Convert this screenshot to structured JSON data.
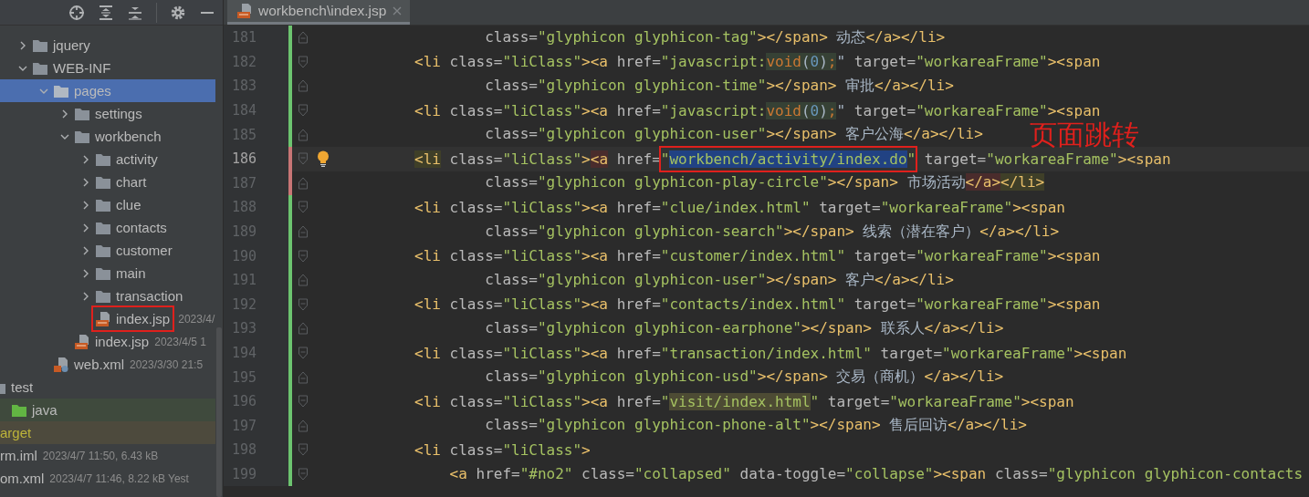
{
  "project_tree": {
    "groups": [
      {
        "kind": "webapp",
        "items": [
          {
            "name": "jquery",
            "kind": "folder",
            "expanded": false,
            "selected": false
          },
          {
            "name": "WEB-INF",
            "kind": "folder",
            "expanded": true,
            "selected": false,
            "children": [
              {
                "name": "pages",
                "kind": "folder",
                "expanded": true,
                "selected": true,
                "children": [
                  {
                    "name": "settings",
                    "kind": "folder",
                    "expanded": false,
                    "selected": false
                  },
                  {
                    "name": "workbench",
                    "kind": "folder",
                    "expanded": true,
                    "selected": false,
                    "children": [
                      {
                        "name": "activity",
                        "kind": "folder",
                        "expanded": false,
                        "selected": false
                      },
                      {
                        "name": "chart",
                        "kind": "folder",
                        "expanded": false,
                        "selected": false
                      },
                      {
                        "name": "clue",
                        "kind": "folder",
                        "expanded": false,
                        "selected": false
                      },
                      {
                        "name": "contacts",
                        "kind": "folder",
                        "expanded": false,
                        "selected": false
                      },
                      {
                        "name": "customer",
                        "kind": "folder",
                        "expanded": false,
                        "selected": false
                      },
                      {
                        "name": "main",
                        "kind": "folder",
                        "expanded": false,
                        "selected": false
                      },
                      {
                        "name": "transaction",
                        "kind": "folder",
                        "expanded": false,
                        "selected": false
                      },
                      {
                        "name": "index.jsp",
                        "kind": "jsp",
                        "info": "2023/4/",
                        "selected": false,
                        "annotated": true
                      }
                    ]
                  },
                  {
                    "name": "index.jsp",
                    "kind": "jsp",
                    "info": "2023/4/5 1",
                    "selected": false
                  }
                ]
              },
              {
                "name": "web.xml",
                "kind": "web_xml",
                "info": "2023/3/30 21:5",
                "selected": false
              }
            ]
          }
        ]
      },
      {
        "kind": "source",
        "items": [
          {
            "name": "test",
            "kind": "folder",
            "selected": false,
            "children": [
              {
                "name": "java",
                "kind": "source_folder",
                "selected": false
              }
            ]
          }
        ]
      },
      {
        "kind": "project",
        "items": [
          {
            "name": "arget",
            "kind": "excluded",
            "selected": false
          },
          {
            "name": "rm.iml",
            "kind": "file",
            "info": "2023/4/7 11:50, 6.43 kB",
            "selected": false
          },
          {
            "name": "om.xml",
            "kind": "file",
            "info": "2023/4/7 11:46, 8.22 kB Yest",
            "selected": false
          }
        ]
      }
    ]
  },
  "editor": {
    "tabs": [
      {
        "title": "workbench\\index.jsp",
        "selected": true
      }
    ],
    "annotation": {
      "text": "页面跳转"
    },
    "lines": [
      {
        "number": "181",
        "kind": "continuation",
        "changed": false,
        "segments": [
          {
            "kind": "attr",
            "text": "class="
          },
          {
            "kind": "str",
            "text": "\"glyphicon glyphicon-tag\""
          },
          {
            "kind": "tag",
            "text": "></span>"
          },
          {
            "kind": "plain",
            "text": " 动态"
          },
          {
            "kind": "tag",
            "text": "</a></li>"
          }
        ]
      },
      {
        "number": "182",
        "kind": "tag",
        "changed": false,
        "segments": [
          {
            "kind": "tag",
            "text": "<li "
          },
          {
            "kind": "attr",
            "text": "class="
          },
          {
            "kind": "str",
            "text": "\"liClass\""
          },
          {
            "kind": "tag",
            "text": "><a "
          },
          {
            "kind": "attr",
            "text": "href="
          },
          {
            "kind": "str",
            "text": "\"javascript:"
          },
          {
            "kind": "kw",
            "text": "void",
            "injected": true
          },
          {
            "kind": "plain",
            "text": "(",
            "injected": true
          },
          {
            "kind": "num",
            "text": "0",
            "injected": true
          },
          {
            "kind": "plain",
            "text": ")",
            "injected": true
          },
          {
            "kind": "kw",
            "text": ";",
            "injected": true
          },
          {
            "kind": "plain",
            "text": "\""
          },
          {
            "kind": "attr",
            "text": " target="
          },
          {
            "kind": "str",
            "text": "\"workareaFrame\""
          },
          {
            "kind": "tag",
            "text": "><span"
          }
        ]
      },
      {
        "number": "183",
        "kind": "continuation",
        "changed": false,
        "segments": [
          {
            "kind": "attr",
            "text": "class="
          },
          {
            "kind": "str",
            "text": "\"glyphicon glyphicon-time\""
          },
          {
            "kind": "tag",
            "text": "></span>"
          },
          {
            "kind": "plain",
            "text": " 审批"
          },
          {
            "kind": "tag",
            "text": "</a></li>"
          }
        ]
      },
      {
        "number": "184",
        "kind": "tag",
        "changed": false,
        "segments": [
          {
            "kind": "tag",
            "text": "<li "
          },
          {
            "kind": "attr",
            "text": "class="
          },
          {
            "kind": "str",
            "text": "\"liClass\""
          },
          {
            "kind": "tag",
            "text": "><a "
          },
          {
            "kind": "attr",
            "text": "href="
          },
          {
            "kind": "str",
            "text": "\"javascript:"
          },
          {
            "kind": "kw",
            "text": "void",
            "injected": true
          },
          {
            "kind": "plain",
            "text": "(",
            "injected": true
          },
          {
            "kind": "num",
            "text": "0",
            "injected": true
          },
          {
            "kind": "plain",
            "text": ")",
            "injected": true
          },
          {
            "kind": "kw",
            "text": ";",
            "injected": true
          },
          {
            "kind": "plain",
            "text": "\""
          },
          {
            "kind": "attr",
            "text": " target="
          },
          {
            "kind": "str",
            "text": "\"workareaFrame\""
          },
          {
            "kind": "tag",
            "text": "><span"
          }
        ]
      },
      {
        "number": "185",
        "kind": "continuation",
        "changed": false,
        "segments": [
          {
            "kind": "attr",
            "text": "class="
          },
          {
            "kind": "str",
            "text": "\"glyphicon glyphicon-user\""
          },
          {
            "kind": "tag",
            "text": "></span>"
          },
          {
            "kind": "plain",
            "text": " 客户公海"
          },
          {
            "kind": "tag",
            "text": "</a></li>"
          }
        ]
      },
      {
        "number": "186",
        "kind": "tag",
        "changed": true,
        "current": true,
        "intention": true,
        "segments": [
          {
            "kind": "tag",
            "text": "<li",
            "matched": true
          },
          {
            "kind": "attr",
            "text": " class="
          },
          {
            "kind": "str",
            "text": "\"liClass\""
          },
          {
            "kind": "tag",
            "text": ">"
          },
          {
            "kind": "tag",
            "text": "<a",
            "unmatched": true
          },
          {
            "kind": "attr",
            "text": " href="
          },
          {
            "kind": "str",
            "text": "\"",
            "annotated": true
          },
          {
            "kind": "str",
            "text": "workbench/activity/index.do",
            "selected": true,
            "annotated": true
          },
          {
            "kind": "str",
            "text": "\"",
            "annotated": true
          },
          {
            "kind": "attr",
            "text": " target="
          },
          {
            "kind": "str",
            "text": "\"workareaFrame\""
          },
          {
            "kind": "tag",
            "text": "><span"
          }
        ]
      },
      {
        "number": "187",
        "kind": "continuation",
        "changed": true,
        "segments": [
          {
            "kind": "attr",
            "text": "class="
          },
          {
            "kind": "str",
            "text": "\"glyphicon glyphicon-play-circle\""
          },
          {
            "kind": "tag",
            "text": "></span>"
          },
          {
            "kind": "plain",
            "text": " 市场活动"
          },
          {
            "kind": "tag",
            "text": "</a>",
            "unmatched": true
          },
          {
            "kind": "tag",
            "text": "</li>",
            "matched": true
          }
        ]
      },
      {
        "number": "188",
        "kind": "tag",
        "changed": false,
        "segments": [
          {
            "kind": "tag",
            "text": "<li "
          },
          {
            "kind": "attr",
            "text": "class="
          },
          {
            "kind": "str",
            "text": "\"liClass\""
          },
          {
            "kind": "tag",
            "text": "><a "
          },
          {
            "kind": "attr",
            "text": "href="
          },
          {
            "kind": "str",
            "text": "\"clue/index.html\""
          },
          {
            "kind": "attr",
            "text": " target="
          },
          {
            "kind": "str",
            "text": "\"workareaFrame\""
          },
          {
            "kind": "tag",
            "text": "><span"
          }
        ]
      },
      {
        "number": "189",
        "kind": "continuation",
        "changed": false,
        "segments": [
          {
            "kind": "attr",
            "text": "class="
          },
          {
            "kind": "str",
            "text": "\"glyphicon glyphicon-search\""
          },
          {
            "kind": "tag",
            "text": "></span>"
          },
          {
            "kind": "plain",
            "text": " 线索（潜在客户）"
          },
          {
            "kind": "tag",
            "text": "</a></li>"
          }
        ]
      },
      {
        "number": "190",
        "kind": "tag",
        "changed": false,
        "segments": [
          {
            "kind": "tag",
            "text": "<li "
          },
          {
            "kind": "attr",
            "text": "class="
          },
          {
            "kind": "str",
            "text": "\"liClass\""
          },
          {
            "kind": "tag",
            "text": "><a "
          },
          {
            "kind": "attr",
            "text": "href="
          },
          {
            "kind": "str",
            "text": "\"customer/index.html\""
          },
          {
            "kind": "attr",
            "text": " target="
          },
          {
            "kind": "str",
            "text": "\"workareaFrame\""
          },
          {
            "kind": "tag",
            "text": "><span"
          }
        ]
      },
      {
        "number": "191",
        "kind": "continuation",
        "changed": false,
        "segments": [
          {
            "kind": "attr",
            "text": "class="
          },
          {
            "kind": "str",
            "text": "\"glyphicon glyphicon-user\""
          },
          {
            "kind": "tag",
            "text": "></span>"
          },
          {
            "kind": "plain",
            "text": " 客户"
          },
          {
            "kind": "tag",
            "text": "</a></li>"
          }
        ]
      },
      {
        "number": "192",
        "kind": "tag",
        "changed": false,
        "segments": [
          {
            "kind": "tag",
            "text": "<li "
          },
          {
            "kind": "attr",
            "text": "class="
          },
          {
            "kind": "str",
            "text": "\"liClass\""
          },
          {
            "kind": "tag",
            "text": "><a "
          },
          {
            "kind": "attr",
            "text": "href="
          },
          {
            "kind": "str",
            "text": "\"contacts/index.html\""
          },
          {
            "kind": "attr",
            "text": " target="
          },
          {
            "kind": "str",
            "text": "\"workareaFrame\""
          },
          {
            "kind": "tag",
            "text": "><span"
          }
        ]
      },
      {
        "number": "193",
        "kind": "continuation",
        "changed": false,
        "segments": [
          {
            "kind": "attr",
            "text": "class="
          },
          {
            "kind": "str",
            "text": "\"glyphicon glyphicon-earphone\""
          },
          {
            "kind": "tag",
            "text": "></span>"
          },
          {
            "kind": "plain",
            "text": " 联系人"
          },
          {
            "kind": "tag",
            "text": "</a></li>"
          }
        ]
      },
      {
        "number": "194",
        "kind": "tag",
        "changed": false,
        "segments": [
          {
            "kind": "tag",
            "text": "<li "
          },
          {
            "kind": "attr",
            "text": "class="
          },
          {
            "kind": "str",
            "text": "\"liClass\""
          },
          {
            "kind": "tag",
            "text": "><a "
          },
          {
            "kind": "attr",
            "text": "href="
          },
          {
            "kind": "str",
            "text": "\"transaction/index.html\""
          },
          {
            "kind": "attr",
            "text": " target="
          },
          {
            "kind": "str",
            "text": "\"workareaFrame\""
          },
          {
            "kind": "tag",
            "text": "><span"
          }
        ]
      },
      {
        "number": "195",
        "kind": "continuation",
        "changed": false,
        "segments": [
          {
            "kind": "attr",
            "text": "class="
          },
          {
            "kind": "str",
            "text": "\"glyphicon glyphicon-usd\""
          },
          {
            "kind": "tag",
            "text": "></span>"
          },
          {
            "kind": "plain",
            "text": " 交易（商机）"
          },
          {
            "kind": "tag",
            "text": "</a></li>"
          }
        ]
      },
      {
        "number": "196",
        "kind": "tag",
        "changed": false,
        "segments": [
          {
            "kind": "tag",
            "text": "<li "
          },
          {
            "kind": "attr",
            "text": "class="
          },
          {
            "kind": "str",
            "text": "\"liClass\""
          },
          {
            "kind": "tag",
            "text": "><a "
          },
          {
            "kind": "attr",
            "text": "href="
          },
          {
            "kind": "str",
            "text": "\""
          },
          {
            "kind": "str",
            "text": "visit/index.html",
            "highlighted": true
          },
          {
            "kind": "str",
            "text": "\""
          },
          {
            "kind": "attr",
            "text": " target="
          },
          {
            "kind": "str",
            "text": "\"workareaFrame\""
          },
          {
            "kind": "tag",
            "text": "><span"
          }
        ]
      },
      {
        "number": "197",
        "kind": "continuation",
        "changed": false,
        "segments": [
          {
            "kind": "attr",
            "text": "class="
          },
          {
            "kind": "str",
            "text": "\"glyphicon glyphicon-phone-alt\""
          },
          {
            "kind": "tag",
            "text": "></span>"
          },
          {
            "kind": "plain",
            "text": " 售后回访"
          },
          {
            "kind": "tag",
            "text": "</a></li>"
          }
        ]
      },
      {
        "number": "198",
        "kind": "tag",
        "changed": false,
        "segments": [
          {
            "kind": "tag",
            "text": "<li "
          },
          {
            "kind": "attr",
            "text": "class="
          },
          {
            "kind": "str",
            "text": "\"liClass\""
          },
          {
            "kind": "tag",
            "text": ">"
          }
        ]
      },
      {
        "number": "199",
        "kind": "nested",
        "changed": false,
        "segments": [
          {
            "kind": "tag",
            "text": "<a "
          },
          {
            "kind": "attr",
            "text": "href="
          },
          {
            "kind": "str",
            "text": "\"#no2\""
          },
          {
            "kind": "attr",
            "text": " class="
          },
          {
            "kind": "str",
            "text": "\"collapsed\""
          },
          {
            "kind": "attr",
            "text": " data-toggle="
          },
          {
            "kind": "str",
            "text": "\"collapse\""
          },
          {
            "kind": "tag",
            "text": "><span "
          },
          {
            "kind": "attr",
            "text": "class="
          },
          {
            "kind": "str",
            "text": "\"glyphicon glyphicon-contacts"
          }
        ]
      }
    ]
  }
}
